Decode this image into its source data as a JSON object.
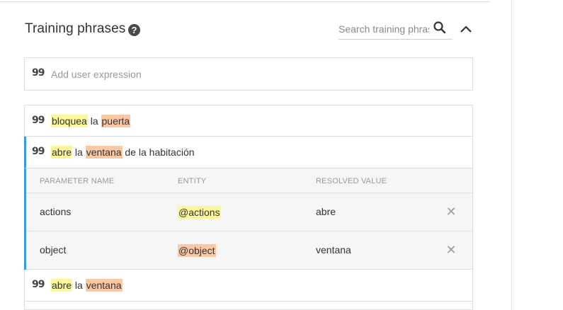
{
  "section": {
    "title": "Training phrases",
    "help_icon": "help-circle-icon",
    "search_placeholder": "Search training phrases",
    "search_icon": "search-icon",
    "collapse_icon": "chevron-up-icon"
  },
  "add_expression": {
    "placeholder": "Add user expression",
    "icon": "quote-icon"
  },
  "phrases": [
    {
      "segments": [
        {
          "text": "bloquea",
          "hl": "yellow"
        },
        {
          "text": " la ",
          "hl": ""
        },
        {
          "text": "puerta",
          "hl": "orange"
        }
      ]
    },
    {
      "segments": [
        {
          "text": "abre",
          "hl": "yellow"
        },
        {
          "text": " la ",
          "hl": ""
        },
        {
          "text": "ventana",
          "hl": "orange"
        },
        {
          "text": " de la habitación",
          "hl": ""
        }
      ]
    },
    {
      "segments": [
        {
          "text": "abre",
          "hl": "yellow"
        },
        {
          "text": " la ",
          "hl": ""
        },
        {
          "text": "ventana",
          "hl": "orange"
        }
      ]
    }
  ],
  "params": {
    "headers": [
      "PARAMETER NAME",
      "ENTITY",
      "RESOLVED VALUE"
    ],
    "rows": [
      {
        "name": "actions",
        "entity": "@actions",
        "value": "abre",
        "hl": "yellow"
      },
      {
        "name": "object",
        "entity": "@object",
        "value": "ventana",
        "hl": "orange"
      }
    ],
    "remove_icon": "close-icon"
  },
  "colors": {
    "highlight_yellow": "#fbf79a",
    "highlight_orange": "#fbc8a6",
    "active_accent": "#3c9ae0"
  }
}
